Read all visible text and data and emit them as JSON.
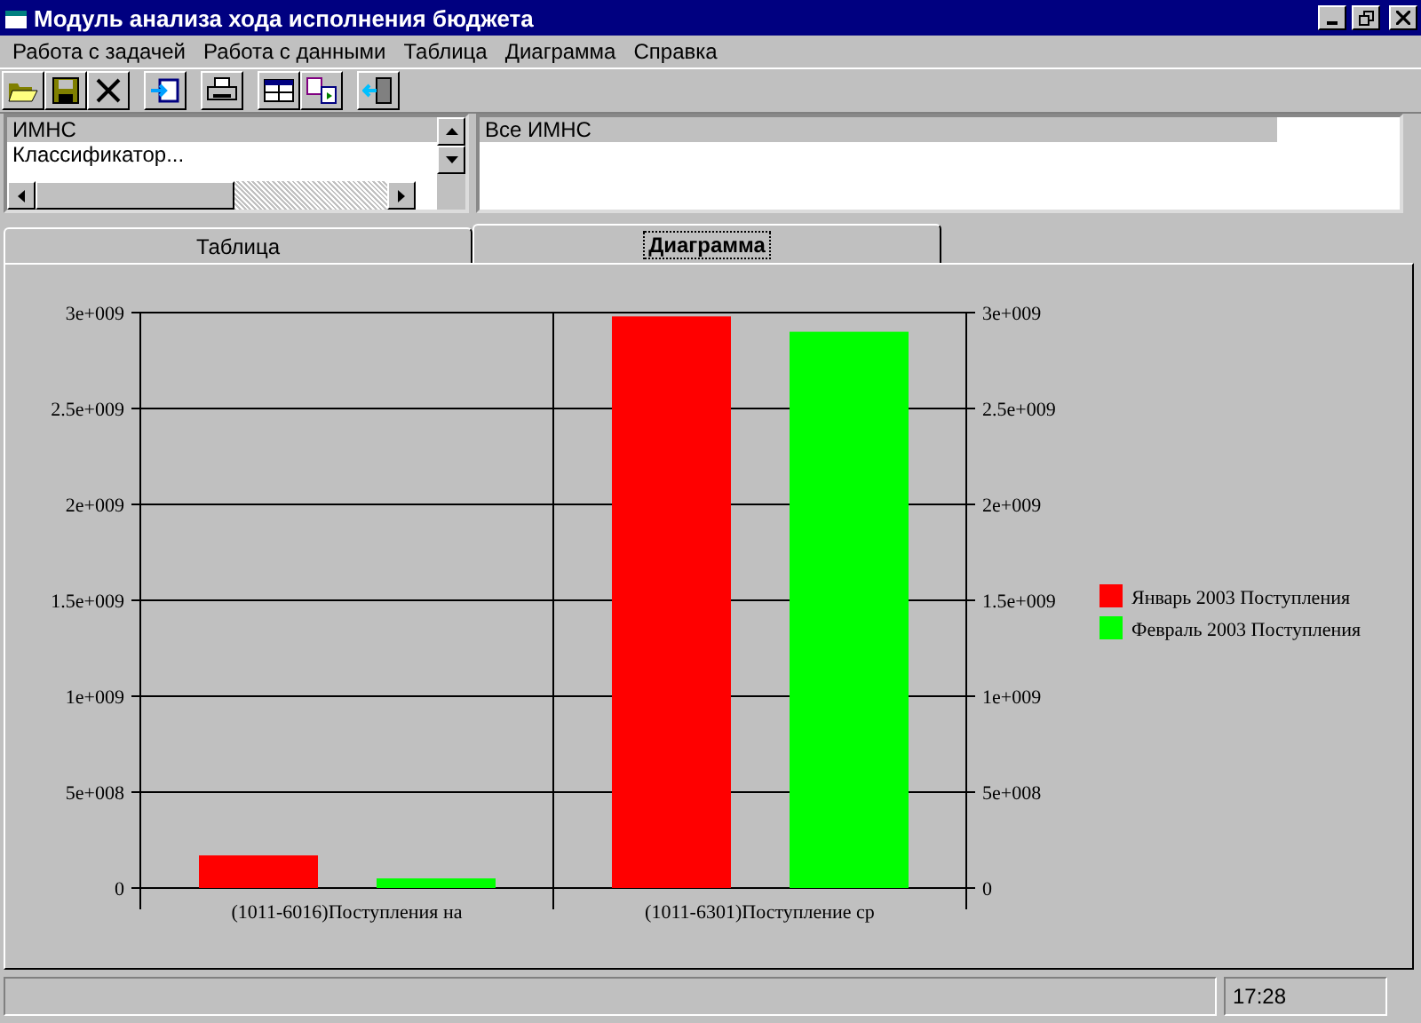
{
  "window": {
    "title": "Модуль анализа хода исполнения бюджета"
  },
  "menu": [
    "Работа с задачей",
    "Работа с данными",
    "Таблица",
    "Диаграмма",
    "Справка"
  ],
  "left_list": {
    "items": [
      {
        "label": "ИМНС",
        "selected": true
      },
      {
        "label": "Классификатор...",
        "selected": false
      }
    ]
  },
  "right_list": {
    "items": [
      {
        "label": "Все ИМНС",
        "selected": true
      }
    ]
  },
  "tabs": [
    {
      "label": "Таблица",
      "selected": false
    },
    {
      "label": "Диаграмма",
      "selected": true
    }
  ],
  "chart_data": {
    "type": "bar",
    "categories": [
      "(1011-6016)Поступления на",
      "(1011-6301)Поступление ср"
    ],
    "series": [
      {
        "name": "Январь 2003 Поступления",
        "color": "#ff0000",
        "values": [
          170000000,
          2980000000
        ]
      },
      {
        "name": "Февраль 2003 Поступления",
        "color": "#00ff00",
        "values": [
          50000000,
          2900000000
        ]
      }
    ],
    "ylim": [
      0,
      3000000000
    ],
    "grid": true,
    "legend": true,
    "yticks": [
      {
        "value": 0,
        "label": "0"
      },
      {
        "value": 500000000,
        "label": "5e+008"
      },
      {
        "value": 1000000000,
        "label": "1e+009"
      },
      {
        "value": 1500000000,
        "label": "1.5e+009"
      },
      {
        "value": 2000000000,
        "label": "2e+009"
      },
      {
        "value": 2500000000,
        "label": "2.5e+009"
      },
      {
        "value": 3000000000,
        "label": "3e+009"
      }
    ]
  },
  "status_bar": {
    "time": "17:28"
  }
}
